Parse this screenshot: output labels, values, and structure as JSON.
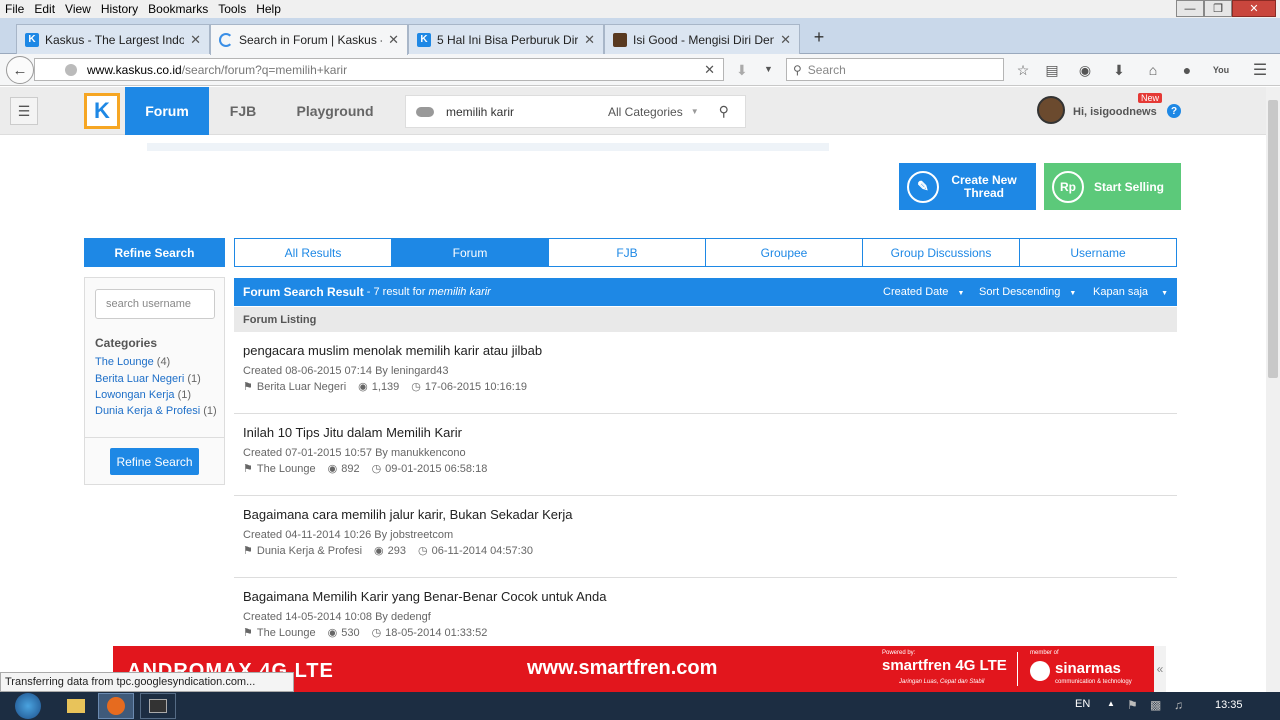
{
  "browser": {
    "menu": [
      "File",
      "Edit",
      "View",
      "History",
      "Bookmarks",
      "Tools",
      "Help"
    ],
    "tabs": [
      {
        "label": "Kaskus - The Largest Indon...",
        "active": false
      },
      {
        "label": "Search in Forum | Kaskus - ...",
        "active": true
      },
      {
        "label": "5 Hal Ini Bisa Perburuk Diri...",
        "active": false
      },
      {
        "label": "Isi Good - Mengisi Diri Den...",
        "active": false
      }
    ],
    "new_tab": "+",
    "url_host": "www.kaskus.co.id",
    "url_path": "/search/forum?q=memilih+karir",
    "search_placeholder": "Search",
    "status": "Transferring data from tpc.googlesyndication.com..."
  },
  "header": {
    "logo": "K",
    "nav": [
      "Forum",
      "FJB",
      "Playground"
    ],
    "search_value": "memilih karir",
    "category": "All Categories",
    "greeting": "Hi, isigoodnews",
    "new_badge": "New",
    "help": "?"
  },
  "actions": {
    "create_thread": "Create New Thread",
    "start_selling": "Start Selling",
    "rp": "Rp"
  },
  "refine": {
    "title": "Refine Search",
    "username_placeholder": "search username",
    "categories_label": "Categories",
    "categories": [
      {
        "name": "The Lounge",
        "count": "(4)"
      },
      {
        "name": "Berita Luar Negeri",
        "count": "(1)"
      },
      {
        "name": "Lowongan Kerja",
        "count": "(1)"
      },
      {
        "name": "Dunia Kerja & Profesi",
        "count": "(1)"
      }
    ],
    "button": "Refine Search"
  },
  "result_tabs": [
    "All Results",
    "Forum",
    "FJB",
    "Groupee",
    "Group Discussions",
    "Username"
  ],
  "results": {
    "title": "Forum Search Result",
    "summary": " - 7 result for ",
    "query": "memilih karir",
    "sort_fields": [
      "Created Date",
      "Sort Descending",
      "Kapan saja"
    ],
    "listing_label": "Forum Listing",
    "items": [
      {
        "title": "pengacara muslim menolak memilih karir atau jilbab",
        "created": "Created 08-06-2015 07:14 By leningard43",
        "category": "Berita Luar Negeri",
        "views": "1,139",
        "last": "17-06-2015 10:16:19"
      },
      {
        "title": "Inilah 10 Tips Jitu dalam Memilih Karir",
        "created": "Created 07-01-2015 10:57 By manukkencono",
        "category": "The Lounge",
        "views": "892",
        "last": "09-01-2015 06:58:18"
      },
      {
        "title": "Bagaimana cara memilih jalur karir, Bukan Sekadar Kerja",
        "created": "Created 04-11-2014 10:26 By jobstreetcom",
        "category": "Dunia Kerja & Profesi",
        "views": "293",
        "last": "06-11-2014 04:57:30"
      },
      {
        "title": "Bagaimana Memilih Karir yang Benar-Benar Cocok untuk Anda",
        "created": "Created 14-05-2014 10:08 By dedengf",
        "category": "The Lounge",
        "views": "530",
        "last": "18-05-2014 01:33:52"
      }
    ]
  },
  "ad": {
    "brand_left": "ANDROMAX 4G LTE",
    "url": "www.smartfren.com",
    "powered": "Powered by:",
    "smartfren": "smartfren 4G LTE",
    "tagline": "Jaringan Luas, Cepat dan Stabil",
    "member": "member of",
    "sinarmas": "sinarmas",
    "sinarmas_sub": "communication & technology",
    "collapse": "«"
  },
  "taskbar": {
    "lang": "EN",
    "time": "13:35"
  }
}
